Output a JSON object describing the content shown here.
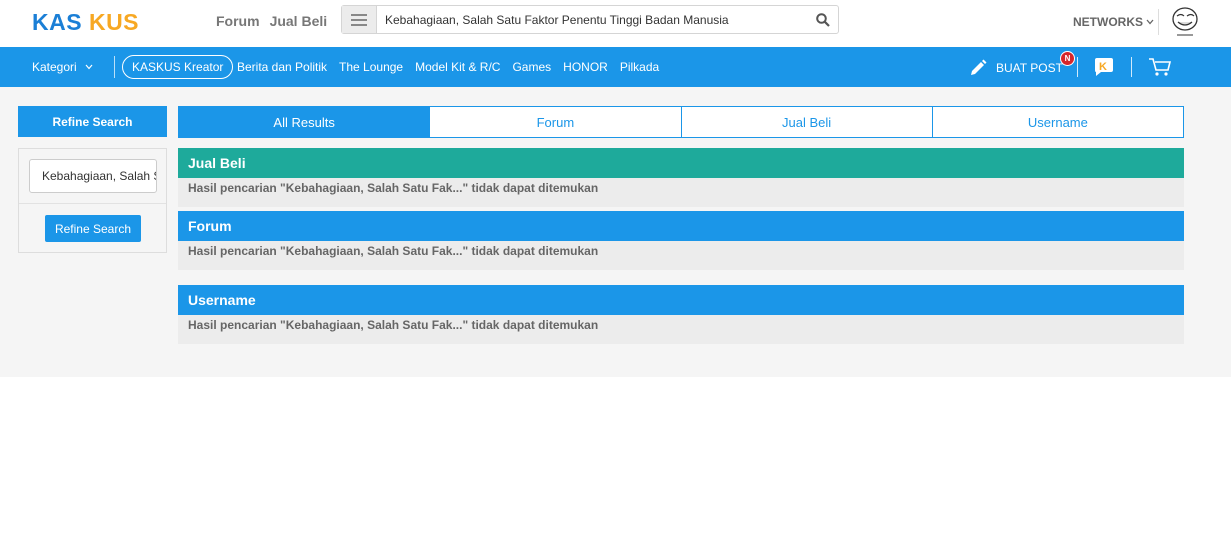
{
  "header": {
    "logo_text": "KASKUS",
    "nav": [
      "Forum",
      "Jual Beli"
    ],
    "search_value": "Kebahagiaan, Salah Satu Faktor Penentu Tinggi Badan Manusia",
    "networks_label": "NETWORKS"
  },
  "navbar": {
    "kategori_label": "Kategori",
    "kreator_label": "KASKUS Kreator",
    "links": [
      "Berita dan Politik",
      "The Lounge",
      "Model Kit & R/C",
      "Games",
      "HONOR",
      "Pilkada"
    ],
    "buat_post_label": "BUAT POST",
    "badge": "N"
  },
  "sidebar": {
    "title": "Refine Search",
    "input_value": "Kebahagiaan, Salah Satu Faktor Penentu Tinggi Badan Manusia",
    "button_label": "Refine Search"
  },
  "tabs": [
    "All Results",
    "Forum",
    "Jual Beli",
    "Username"
  ],
  "sections": [
    {
      "title": "Jual Beli",
      "message": "Hasil pencarian \"Kebahagiaan, Salah Satu Fak...\" tidak dapat ditemukan",
      "color": "#1eaa9b"
    },
    {
      "title": "Forum",
      "message": "Hasil pencarian \"Kebahagiaan, Salah Satu Fak...\" tidak dapat ditemukan",
      "color": "#1b96e8"
    },
    {
      "title": "Username",
      "message": "Hasil pencarian \"Kebahagiaan, Salah Satu Fak...\" tidak dapat ditemukan",
      "color": "#1b96e8"
    }
  ],
  "colors": {
    "primary": "#1b96e8",
    "teal": "#1eaa9b",
    "logo_orange": "#f7a823"
  }
}
